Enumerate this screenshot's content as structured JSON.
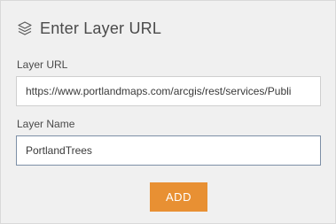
{
  "dialog": {
    "title": "Enter Layer URL",
    "header_icon": "layers-icon"
  },
  "layer_url": {
    "label": "Layer URL",
    "value": "https://www.portlandmaps.com/arcgis/rest/services/Publi"
  },
  "layer_name": {
    "label": "Layer Name",
    "value": "PortlandTrees"
  },
  "actions": {
    "add_label": "ADD"
  },
  "colors": {
    "accent": "#e89033",
    "panel_bg": "#f0f0f0",
    "text": "#4a4a4a",
    "active_border": "#7d8fa6"
  }
}
